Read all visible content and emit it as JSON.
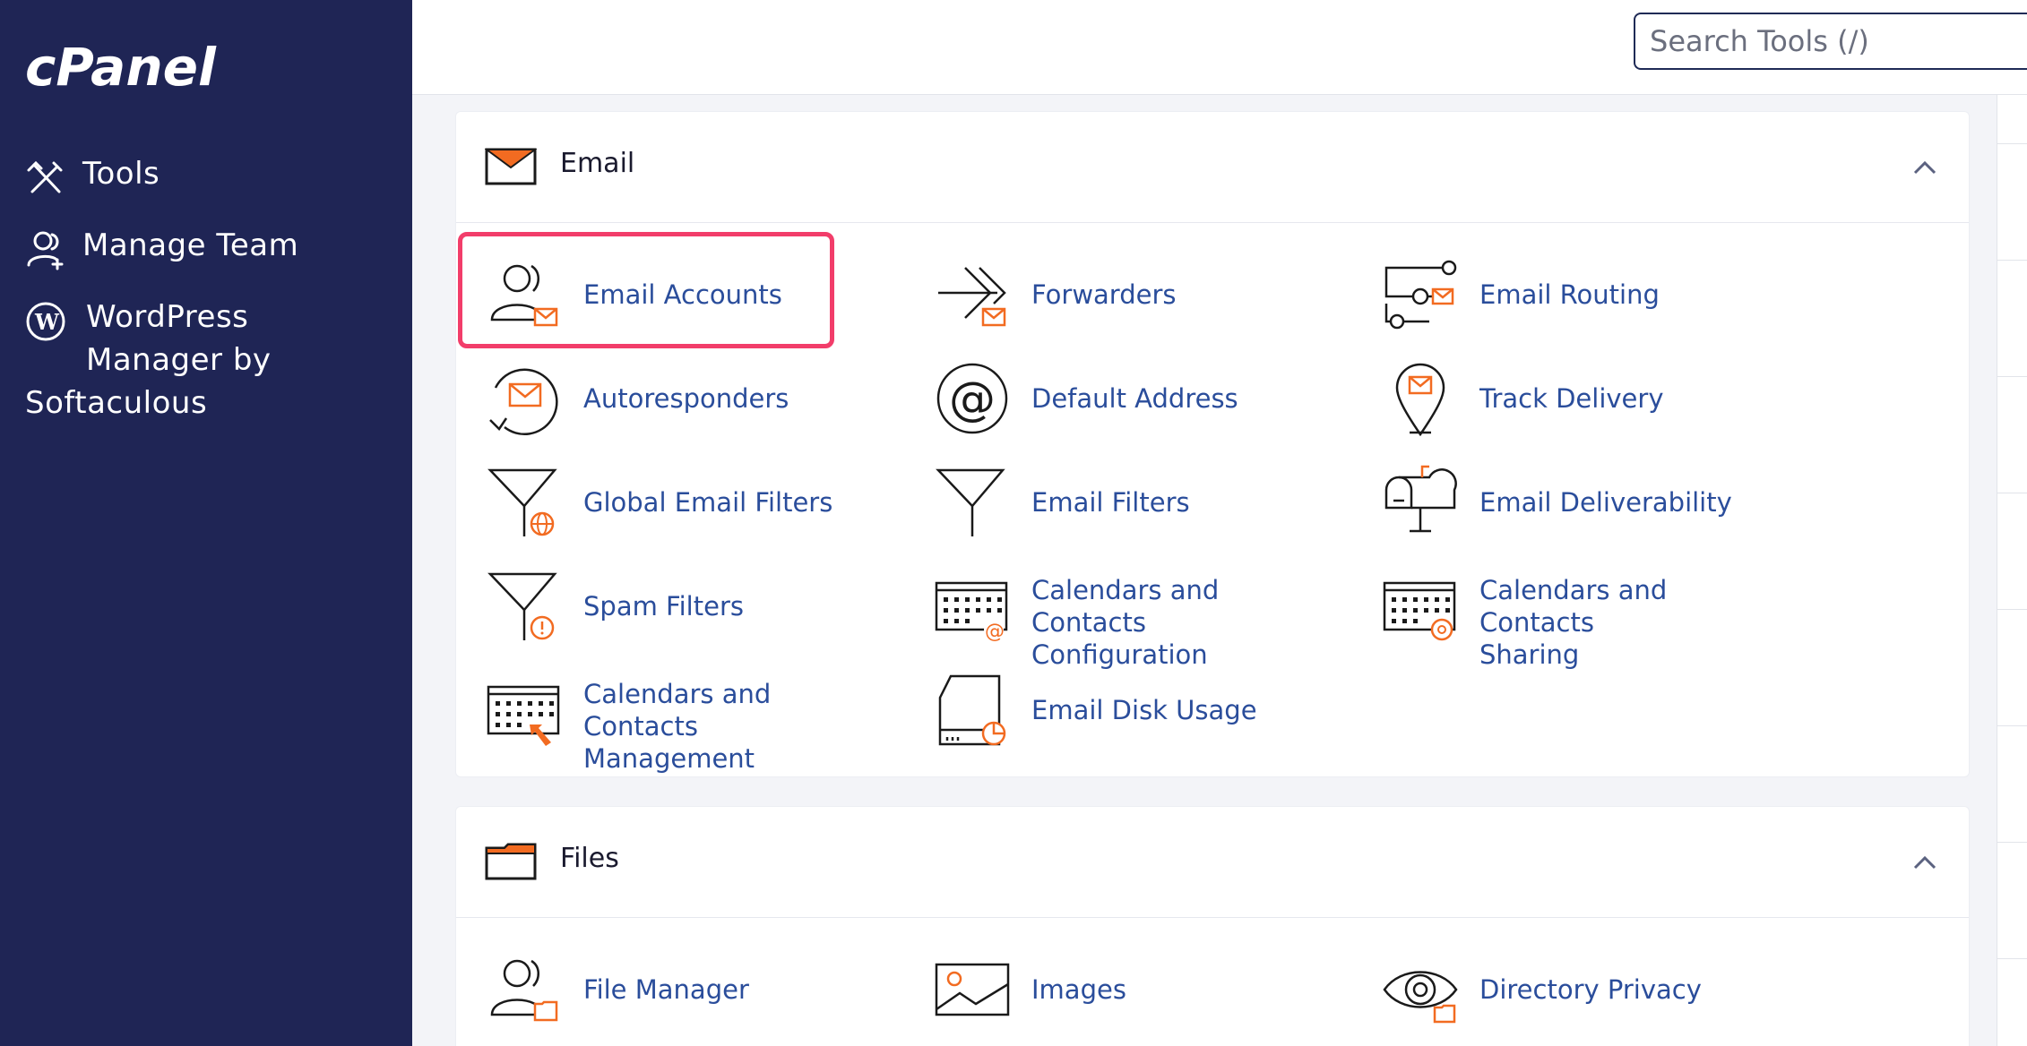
{
  "sidebar": {
    "logo_text": "cPanel",
    "items": [
      {
        "label": "Tools",
        "icon": "tools-icon"
      },
      {
        "label": "Manage Team",
        "icon": "manage-team-icon"
      },
      {
        "label_line1": "WordPress",
        "label_line2": "Manager by",
        "label_line3": "Softaculous",
        "icon": "wordpress-icon"
      }
    ]
  },
  "header": {
    "search_placeholder": "Search Tools (/)"
  },
  "email_section": {
    "title": "Email",
    "tools": [
      {
        "label": "Email Accounts",
        "icon": "email-accounts-icon"
      },
      {
        "label": "Forwarders",
        "icon": "forwarders-icon"
      },
      {
        "label": "Email Routing",
        "icon": "email-routing-icon"
      },
      {
        "label": "Autoresponders",
        "icon": "autoresponders-icon"
      },
      {
        "label": "Default Address",
        "icon": "default-address-icon"
      },
      {
        "label": "Track Delivery",
        "icon": "track-delivery-icon"
      },
      {
        "label": "Global Email Filters",
        "icon": "global-email-filters-icon"
      },
      {
        "label": "Email Filters",
        "icon": "email-filters-icon"
      },
      {
        "label": "Email Deliverability",
        "icon": "email-deliverability-icon"
      },
      {
        "label": "Spam Filters",
        "icon": "spam-filters-icon"
      },
      {
        "label_line1": "Calendars and Contacts",
        "label_line2": "Configuration",
        "icon": "calendars-config-icon"
      },
      {
        "label_line1": "Calendars and Contacts",
        "label_line2": "Sharing",
        "icon": "calendars-sharing-icon"
      },
      {
        "label_line1": "Calendars and Contacts",
        "label_line2": "Management",
        "icon": "calendars-management-icon"
      },
      {
        "label": "Email Disk Usage",
        "icon": "email-disk-usage-icon"
      }
    ]
  },
  "files_section": {
    "title": "Files",
    "tools": [
      {
        "label": "File Manager",
        "icon": "file-manager-icon"
      },
      {
        "label": "Images",
        "icon": "images-icon"
      },
      {
        "label": "Directory Privacy",
        "icon": "directory-privacy-icon"
      }
    ]
  },
  "colors": {
    "sidebar_bg": "#1f2555",
    "link": "#2a4d9b",
    "accent_orange": "#f26b21",
    "highlight": "#f23d6a"
  }
}
